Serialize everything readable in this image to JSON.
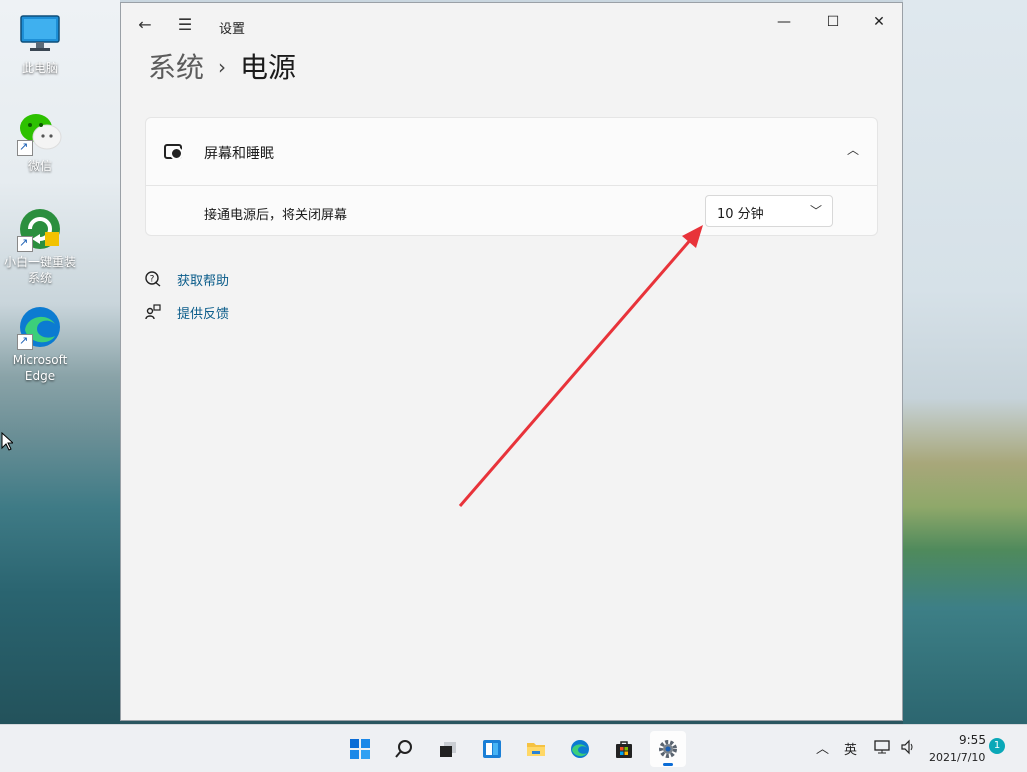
{
  "desktop": {
    "icons": [
      {
        "label": "此电脑"
      },
      {
        "label": "微信"
      },
      {
        "label": "小白一键重装系统"
      },
      {
        "label": "Microsoft Edge"
      }
    ]
  },
  "window": {
    "title": "设置",
    "breadcrumb": {
      "parent": "系统",
      "separator": "›",
      "current": "电源"
    },
    "screen_sleep": {
      "title": "屏幕和睡眠",
      "row_label": "接通电源后，将关闭屏幕",
      "dropdown_value": "10 分钟"
    },
    "links": [
      {
        "label": "获取帮助"
      },
      {
        "label": "提供反馈"
      }
    ]
  },
  "taskbar": {
    "apps": [
      "start-icon",
      "search-icon",
      "task-view-icon",
      "widgets-icon",
      "file-explorer-icon",
      "edge-icon",
      "store-icon",
      "settings-icon"
    ],
    "tray": {
      "ime": "英",
      "time": "9:55",
      "date": "2021/7/10",
      "notification_count": "1"
    }
  },
  "colors": {
    "accent": "#0a5c8a",
    "arrow": "#e8333a"
  }
}
